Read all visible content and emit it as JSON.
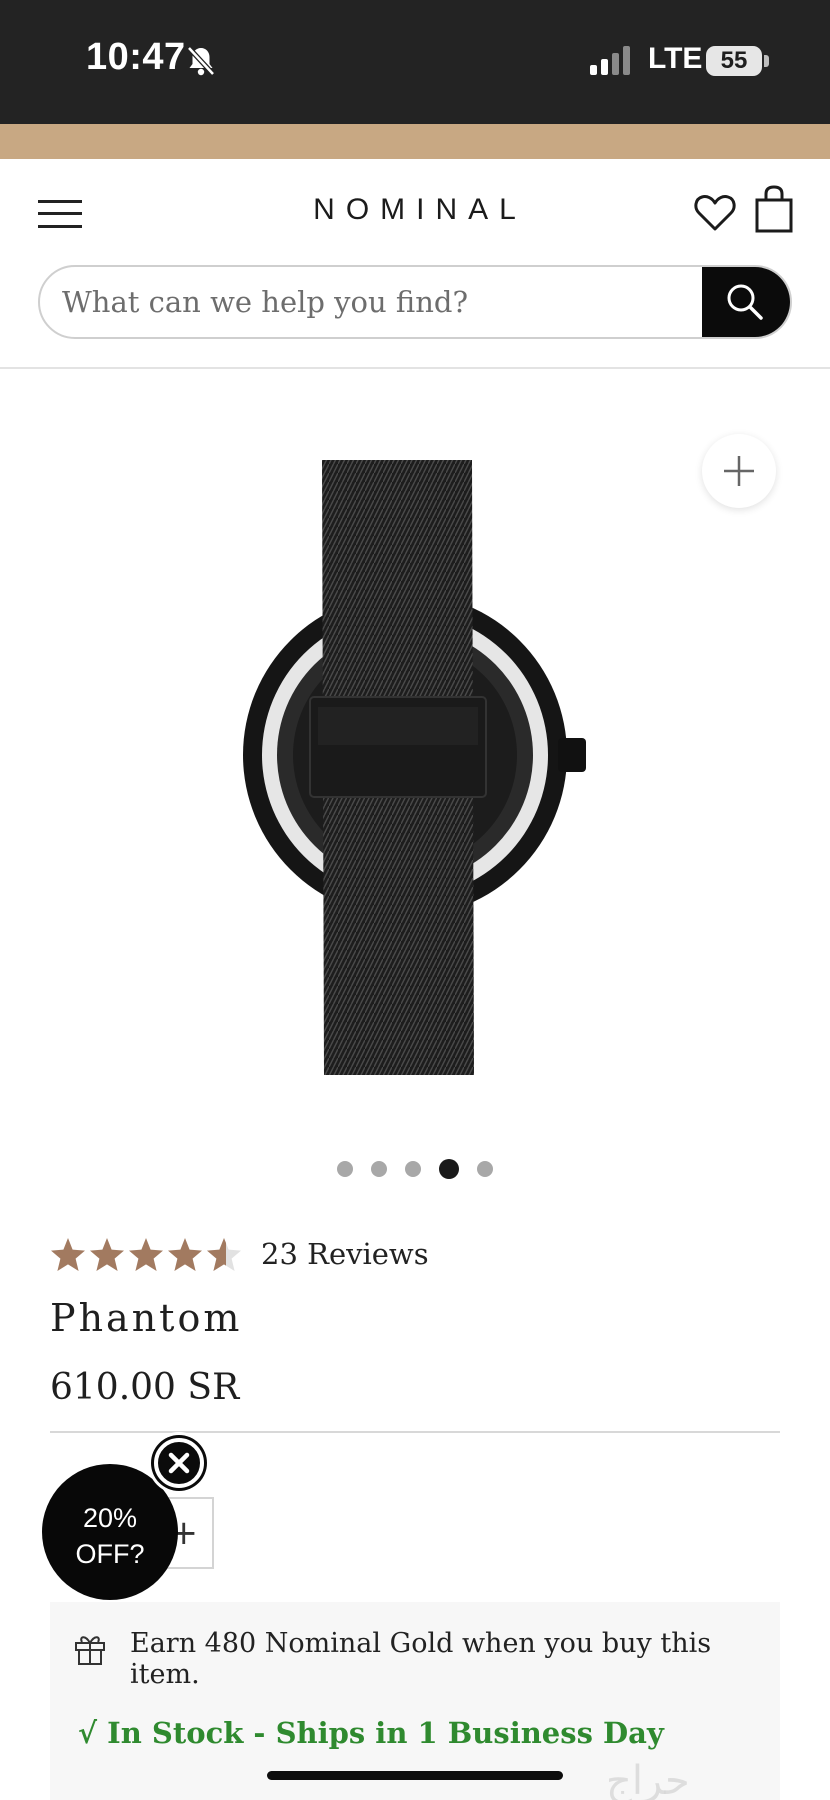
{
  "status_bar": {
    "time": "10:47",
    "network": "LTE",
    "battery": "55",
    "icons": [
      "bell-slash-icon",
      "signal-icon",
      "battery-icon"
    ]
  },
  "header": {
    "brand": "NOMINAL",
    "icons": [
      "menu-icon",
      "heart-icon",
      "bag-icon"
    ],
    "search": {
      "placeholder": "What can we help you find?",
      "button_icon": "search-icon"
    }
  },
  "gallery": {
    "zoom_icon": "plus-icon",
    "image_subject": "watch-back-image",
    "slide_count": 5,
    "active_slide_index": 3
  },
  "product": {
    "rating": 4.5,
    "rating_max": 5,
    "reviews": "23 Reviews",
    "title": "Phantom",
    "price": "610.00 SR"
  },
  "quantity": {
    "increment_symbol": "+"
  },
  "popup": {
    "line1": "20%",
    "line2": "OFF?",
    "close_icon": "close-icon"
  },
  "info": {
    "gift_icon": "gift-icon",
    "rewards_text": "Earn 480 Nominal Gold when you buy this item.",
    "stock_text": "√ In Stock - Ships in 1 Business Day"
  },
  "watermark": "حراج",
  "colors": {
    "status_bar": "#232323",
    "promo_bar": "#c8a883",
    "star": "#a27a60",
    "in_stock": "#2f8a2f",
    "search_button": "#0b0b0b"
  }
}
